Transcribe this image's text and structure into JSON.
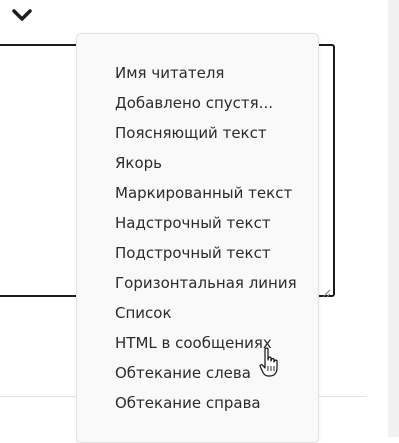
{
  "toolbar": {
    "collapse_icon": "chevron-down-icon"
  },
  "dropdown": {
    "items": [
      {
        "label": "Имя читателя"
      },
      {
        "label": "Добавлено спустя..."
      },
      {
        "label": "Поясняющий текст"
      },
      {
        "label": "Якорь"
      },
      {
        "label": "Маркированный текст"
      },
      {
        "label": "Надстрочный текст"
      },
      {
        "label": "Подстрочный текст"
      },
      {
        "label": "Горизонтальная линия"
      },
      {
        "label": "Список"
      },
      {
        "label": "HTML в сообщениях"
      },
      {
        "label": "Обтекание слева"
      },
      {
        "label": "Обтекание справа"
      }
    ],
    "hovered_item": "HTML в сообщениях"
  },
  "editor": {
    "value": ""
  },
  "colors": {
    "menu_background": "#f9f9f9",
    "menu_text": "#2b2b2b",
    "textarea_border": "#1b1b1b"
  }
}
